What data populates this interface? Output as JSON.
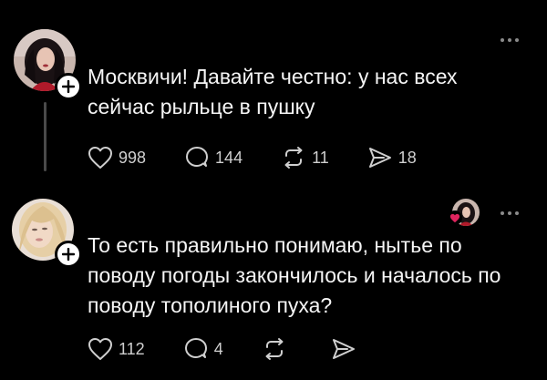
{
  "posts": [
    {
      "text": "Москвичи! Давайте честно: у нас всех сейчас рыльце в пушку",
      "likes": "998",
      "comments": "144",
      "reposts": "11",
      "shares": "18"
    },
    {
      "text": "То есть правильно понимаю, нытье по поводу погоды закончилось и началось по поводу тополиного пуха?",
      "likes": "112",
      "comments": "4",
      "reposts": "",
      "shares": ""
    }
  ],
  "icons": {
    "like": "heart-icon",
    "comment": "comment-bubble-icon",
    "repost": "repost-icon",
    "share": "send-icon",
    "more": "more-dots-icon",
    "follow": "plus-icon"
  },
  "colors": {
    "background": "#000000",
    "text": "#f5f5f5",
    "meta": "#cfcfcf",
    "author_liked_heart": "#e0245e"
  }
}
